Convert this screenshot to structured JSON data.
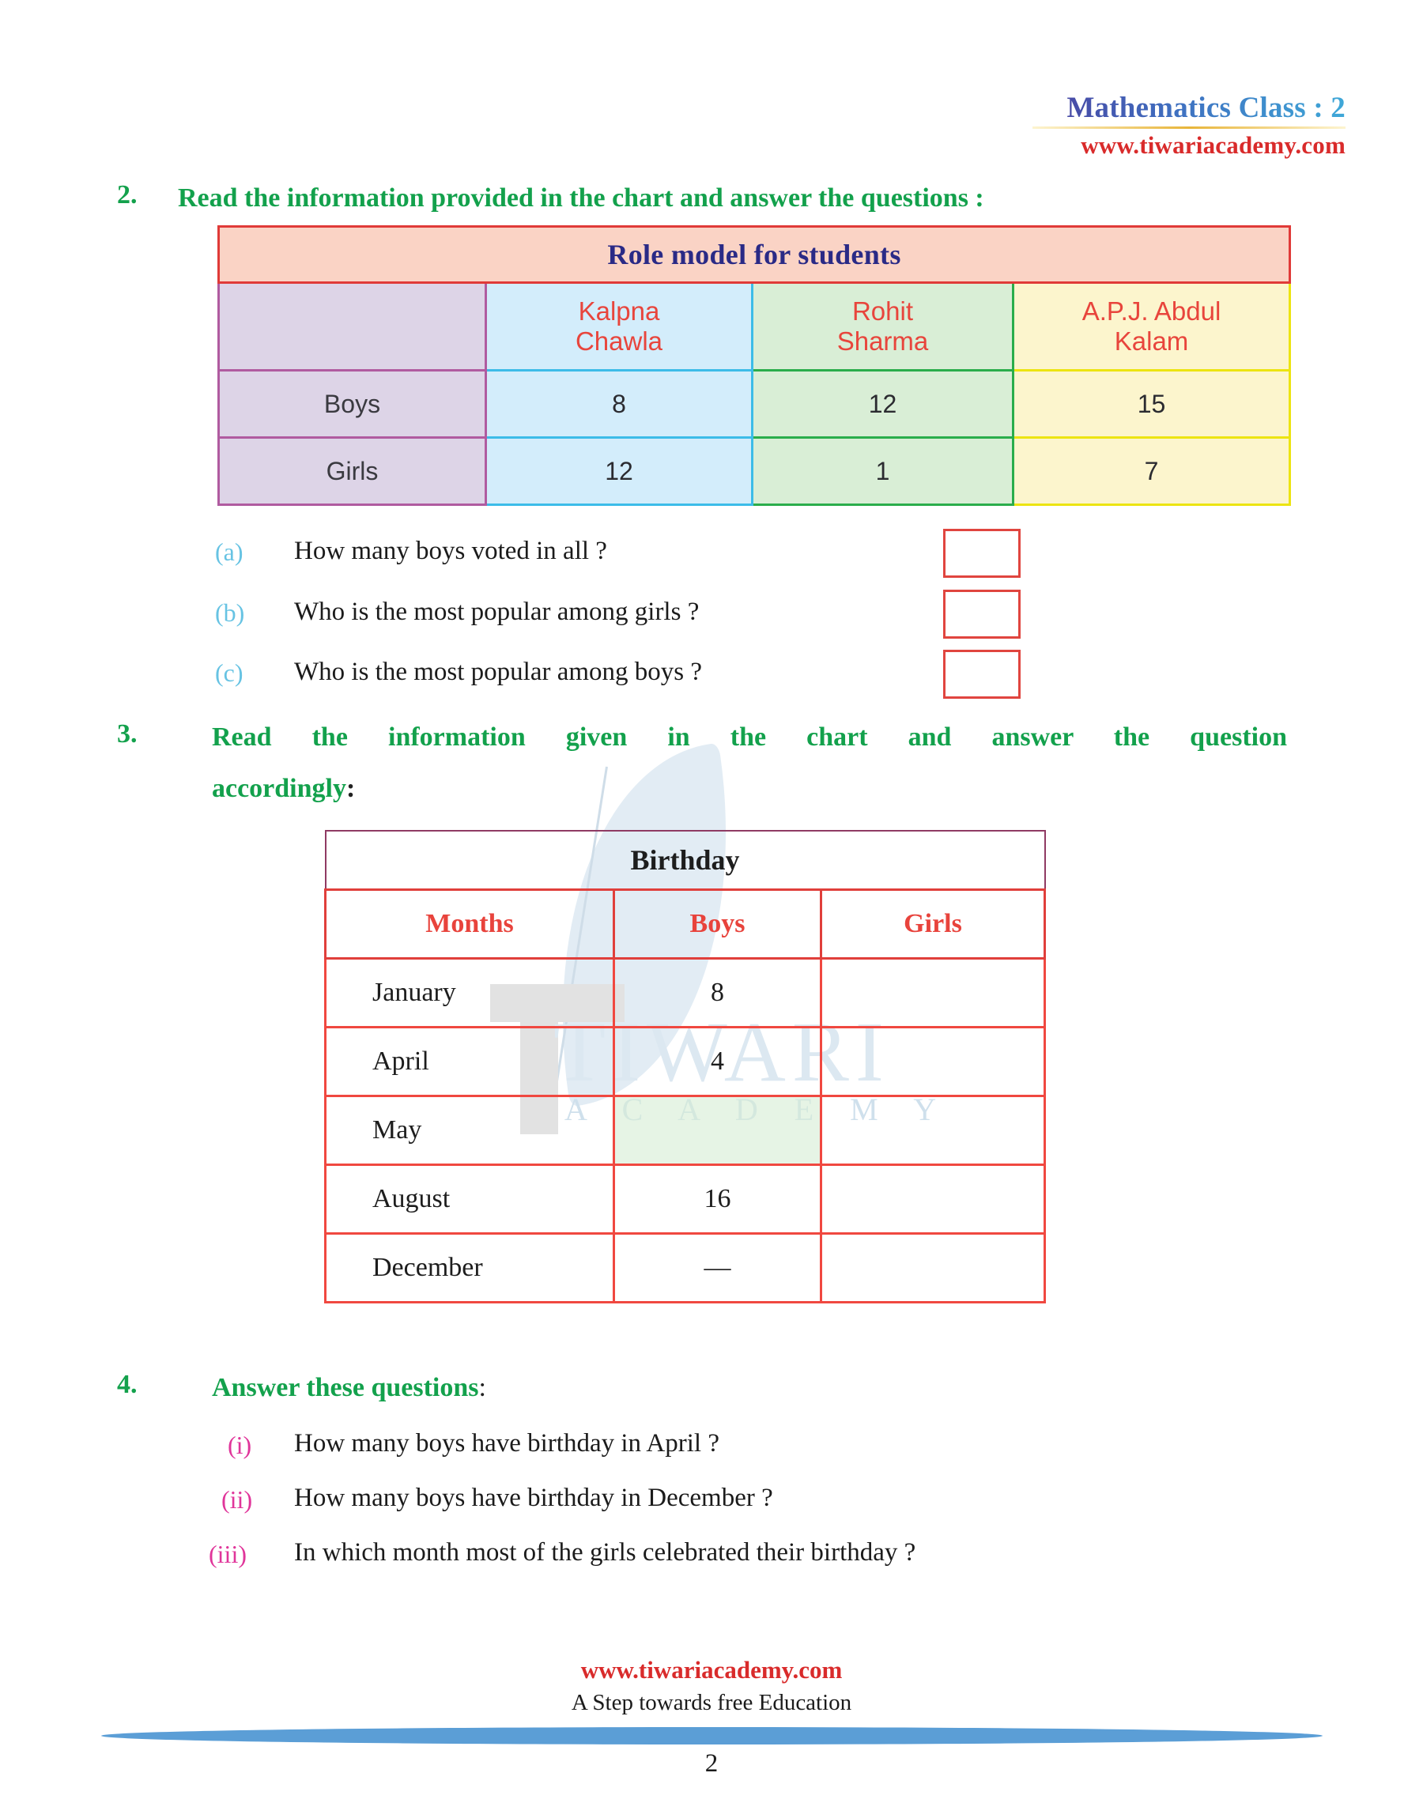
{
  "header": {
    "title": "Mathematics Class : 2",
    "url": "www.tiwariacademy.com"
  },
  "watermark": {
    "word_top": "TIWARI",
    "word_bottom": "A C A D E M Y"
  },
  "question2": {
    "number": "2.",
    "heading": "Read the information provided in the chart and answer the questions :",
    "table": {
      "title": "Role model for students",
      "corner_label": "",
      "columns": [
        "Kalpna\nChawla",
        "Rohit\nSharma",
        "A.P.J. Abdul\nKalam"
      ],
      "columns_line1": [
        "Kalpna",
        "Rohit",
        "A.P.J. Abdul"
      ],
      "columns_line2": [
        "Chawla",
        "Sharma",
        "Kalam"
      ],
      "rows": [
        {
          "label": "Boys",
          "values": [
            "8",
            "12",
            "15"
          ]
        },
        {
          "label": "Girls",
          "values": [
            "12",
            "1",
            "7"
          ]
        }
      ]
    },
    "subquestions": [
      {
        "tag": "(a)",
        "text": "How many boys voted in all ?",
        "answer": ""
      },
      {
        "tag": "(b)",
        "text": "Who is the most popular among girls ?",
        "answer": ""
      },
      {
        "tag": "(c)",
        "text": "Who is the most popular among boys ?",
        "answer": ""
      }
    ]
  },
  "question3": {
    "number": "3.",
    "heading_line1": "Read the information given in the chart and answer the question",
    "heading_line2": "accordingly",
    "heading_colon": ":",
    "table": {
      "title": "Birthday",
      "headers": [
        "Months",
        "Boys",
        "Girls"
      ],
      "rows": [
        {
          "month": "January",
          "boys": "8",
          "girls": ""
        },
        {
          "month": "April",
          "boys": "4",
          "girls": ""
        },
        {
          "month": "May",
          "boys": "",
          "girls": ""
        },
        {
          "month": "August",
          "boys": "16",
          "girls": ""
        },
        {
          "month": "December",
          "boys": "—",
          "girls": ""
        }
      ]
    }
  },
  "question4": {
    "number": "4.",
    "heading": "Answer these questions",
    "heading_colon": ":",
    "items": [
      {
        "tag": "(i)",
        "text": "How many boys have birthday in April ?"
      },
      {
        "tag": "(ii)",
        "text": "How many boys have birthday  in December ?"
      },
      {
        "tag": "(iii)",
        "text": "In which month most of the girls celebrated their birthday ?"
      }
    ]
  },
  "footer": {
    "url": "www.tiwariacademy.com",
    "tagline": "A Step towards free Education",
    "page_number": "2"
  },
  "colors": {
    "green_heading": "#13a14c",
    "red_accent": "#d92b2b",
    "blue_title": "#2b4fa2",
    "pink_roman": "#e0359a",
    "blue_tag": "#67c3e3",
    "table1_title_bg": "#fad3c5",
    "col_lavender": "#ddd4e7",
    "col_blue": "#d3edfb",
    "col_green": "#d9eed6",
    "col_yellow": "#fcf5cd"
  }
}
